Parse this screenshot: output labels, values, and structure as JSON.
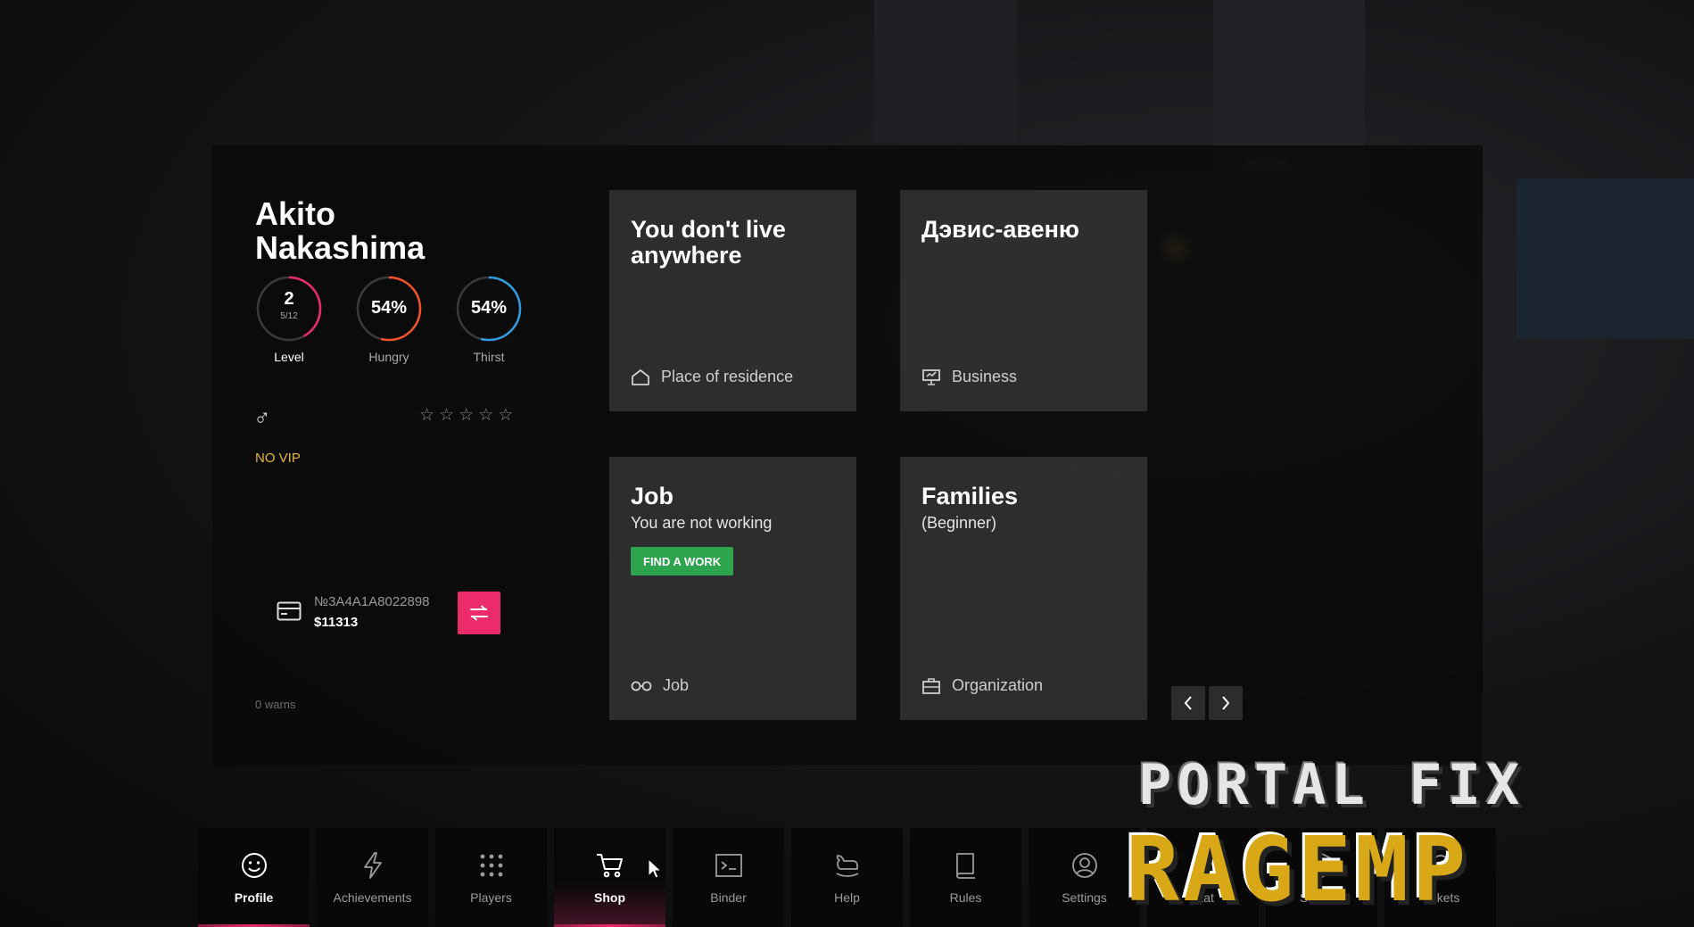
{
  "profile": {
    "first_name": "Akito",
    "last_name": "Nakashima",
    "level": {
      "value": "2",
      "progress_text": "5/12",
      "label": "Level",
      "fraction": 0.42,
      "color": "#ec2b6b"
    },
    "hungry": {
      "value": "54%",
      "label": "Hungry",
      "fraction": 0.54,
      "color": "#f0522c"
    },
    "thirst": {
      "value": "54%",
      "label": "Thirst",
      "fraction": 0.54,
      "color": "#2f9be0"
    },
    "gender_icon": "male-icon",
    "stars": {
      "filled": 0,
      "total": 5
    },
    "vip": "NO VIP",
    "bank": {
      "number": "№3A4A1A8022898",
      "money": "$11313"
    },
    "warns": "0 warns"
  },
  "tiles": {
    "residence": {
      "title": "You don't live anywhere",
      "footer": "Place of residence",
      "icon": "home-icon"
    },
    "business": {
      "title": "Дэвис-авеню",
      "footer": "Business",
      "icon": "presentation-icon"
    },
    "job": {
      "title": "Job",
      "subtitle": "You are not working",
      "button": "FIND A WORK",
      "footer": "Job",
      "icon": "glasses-icon"
    },
    "families": {
      "title": "Families",
      "subtitle": "(Beginner)",
      "footer": "Organization",
      "icon": "briefcase-icon"
    }
  },
  "nav": {
    "items": [
      {
        "label": "Profile",
        "icon": "smiley-icon",
        "active": true
      },
      {
        "label": "Achievements",
        "icon": "lightning-icon"
      },
      {
        "label": "Players",
        "icon": "grid-dots-icon"
      },
      {
        "label": "Shop",
        "icon": "cart-icon",
        "active": true
      },
      {
        "label": "Binder",
        "icon": "terminal-icon"
      },
      {
        "label": "Help",
        "icon": "rocking-horse-icon"
      },
      {
        "label": "Rules",
        "icon": "book-icon"
      },
      {
        "label": "Settings",
        "icon": "user-circle-icon"
      },
      {
        "label": "Stat",
        "icon": "chart-icon"
      },
      {
        "label": "Storage",
        "icon": "box-icon"
      },
      {
        "label": "Tickets",
        "icon": "bell-icon"
      }
    ]
  },
  "watermark": {
    "line1": "PORTAL FIX",
    "line2": "RAGEMP"
  },
  "colors": {
    "accent": "#ec2b6b",
    "vip": "#e6b73d",
    "green": "#2ea44f"
  }
}
